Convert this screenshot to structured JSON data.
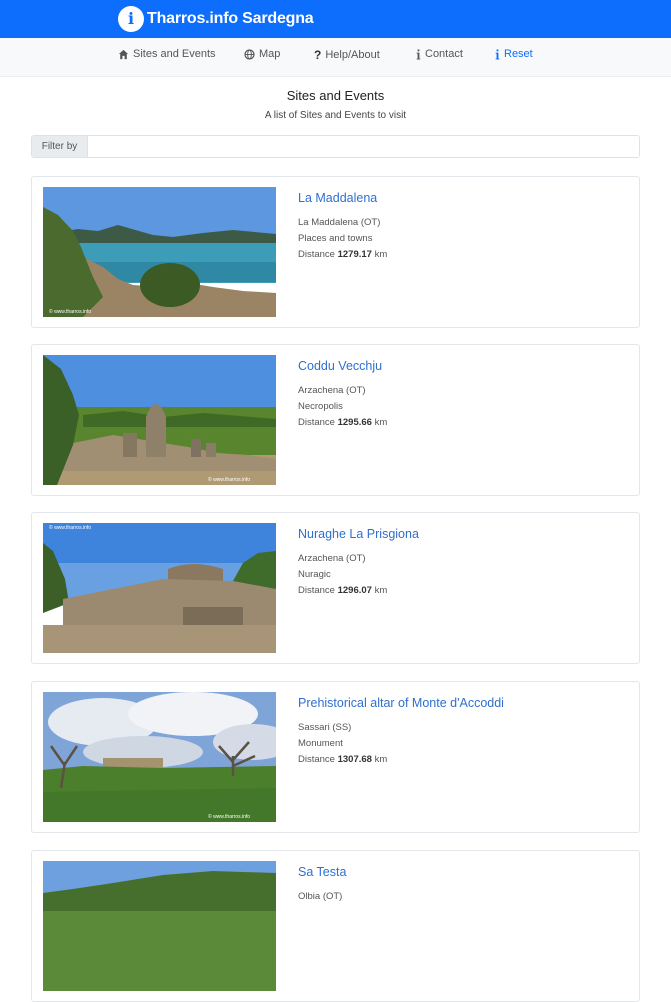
{
  "brand": {
    "name": "Tharros.info Sardegna",
    "logo_letter": "i"
  },
  "nav": [
    {
      "label": "Sites and Events",
      "icon": "home-icon"
    },
    {
      "label": "Map",
      "icon": "globe-icon"
    },
    {
      "label": "Help/About",
      "icon": "question-icon"
    },
    {
      "label": "Contact",
      "icon": "info-icon"
    },
    {
      "label": "Reset",
      "icon": "info-icon"
    }
  ],
  "page": {
    "title": "Sites and Events",
    "subtitle": "A list of Sites and Events to visit"
  },
  "filter": {
    "label": "Filter by",
    "value": "",
    "placeholder": ""
  },
  "distance_label": "Distance",
  "distance_unit": "km",
  "cards": [
    {
      "title": "La Maddalena",
      "location": "La Maddalena (OT)",
      "category": "Places and towns",
      "distance": "1279.17",
      "watermark": "© www.tharros.info"
    },
    {
      "title": "Coddu Vecchju",
      "location": "Arzachena (OT)",
      "category": "Necropolis",
      "distance": "1295.66",
      "watermark": "© www.tharros.info"
    },
    {
      "title": "Nuraghe La Prisgiona",
      "location": "Arzachena (OT)",
      "category": "Nuragic",
      "distance": "1296.07",
      "watermark": "© www.tharros.info"
    },
    {
      "title": "Prehistorical altar of Monte d'Accoddi",
      "location": "Sassari (SS)",
      "category": "Monument",
      "distance": "1307.68",
      "watermark": "© www.tharros.info"
    },
    {
      "title": "Sa Testa",
      "location": "Olbia (OT)",
      "category": "",
      "distance": "",
      "watermark": ""
    }
  ]
}
